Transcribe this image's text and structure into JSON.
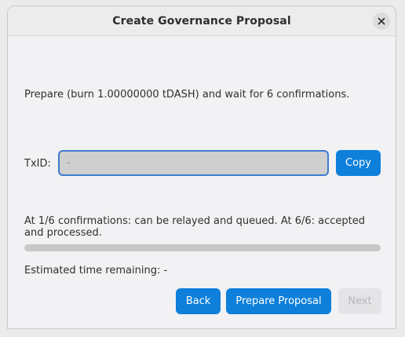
{
  "window": {
    "title": "Create Governance Proposal"
  },
  "prepare": {
    "description": "Prepare (burn 1.00000000 tDASH) and wait for 6 confirmations."
  },
  "txid": {
    "label": "TxID:",
    "value": "-",
    "copy_label": "Copy"
  },
  "status": {
    "confirmations_text": "At 1/6 confirmations: can be relayed and queued. At 6/6: accepted and processed.",
    "progress_fraction": 0,
    "eta_text": "Estimated time remaining: -"
  },
  "buttons": {
    "back_label": "Back",
    "prepare_label": "Prepare Proposal",
    "next_label": "Next",
    "next_enabled": false
  },
  "colors": {
    "accent": "#0e7fdb",
    "input_focus_border": "#3e7bd0"
  },
  "icons": {
    "close": "close-icon"
  }
}
